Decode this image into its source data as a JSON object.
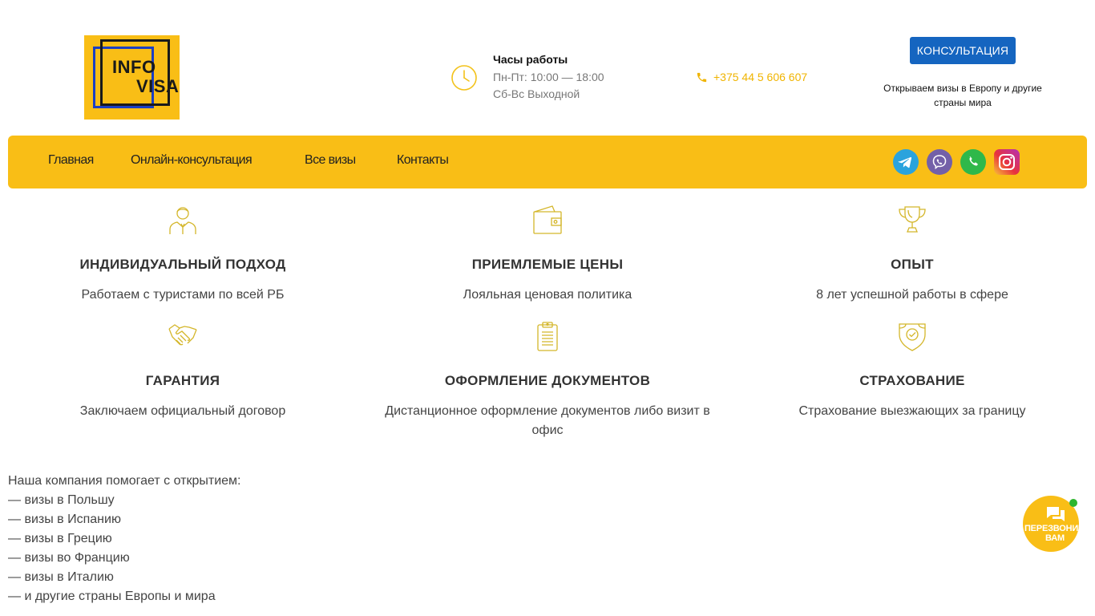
{
  "header": {
    "logo": {
      "line1": "INFO",
      "line2": "VISA"
    },
    "hours": {
      "title": "Часы работы",
      "weekdays": "Пн-Пт: 10:00 — 18:00",
      "weekend": "Сб-Вс Выходной"
    },
    "phone": "+375 44 5 606 607",
    "consult_button": "КОНСУЛЬТАЦИЯ",
    "consult_subtitle": "Открываем визы в Европу и другие страны мира"
  },
  "nav": {
    "items": [
      {
        "label": "Главная"
      },
      {
        "label": "Онлайн-консультация"
      },
      {
        "label": "Все визы"
      },
      {
        "label": "Контакты"
      }
    ],
    "social": [
      "telegram-icon",
      "viber-icon",
      "whatsapp-icon",
      "instagram-icon"
    ]
  },
  "features": [
    {
      "icon": "consultant-icon",
      "title": "ИНДИВИДУАЛЬНЫЙ ПОДХОД",
      "desc": "Работаем с туристами по всей РБ"
    },
    {
      "icon": "wallet-icon",
      "title": "ПРИЕМЛЕМЫЕ ЦЕНЫ",
      "desc": "Лояльная ценовая политика"
    },
    {
      "icon": "trophy-icon",
      "title": "ОПЫТ",
      "desc": "8 лет успешной работы в сфере"
    },
    {
      "icon": "handshake-icon",
      "title": "ГАРАНТИЯ",
      "desc": "Заключаем официальный договор"
    },
    {
      "icon": "clipboard-icon",
      "title": "ОФОРМЛЕНИЕ ДОКУМЕНТОВ",
      "desc": "Дистанционное оформление документов либо визит в офис"
    },
    {
      "icon": "shield-check-icon",
      "title": "СТРАХОВАНИЕ",
      "desc": "Страхование выезжающих за границу"
    }
  ],
  "about": {
    "intro": "Наша компания помогает с открытием:",
    "items": [
      "— визы в Польшу",
      "— визы в Испанию",
      "— визы в Грецию",
      "— визы во Францию",
      "— визы в Италию",
      "— и другие страны Европы и мира"
    ]
  },
  "callback": {
    "line1": "ПЕРЕЗВОНИМ",
    "line2": "ВАМ"
  },
  "colors": {
    "accent": "#f9be16",
    "button": "#1565c0",
    "icon": "#d4b62a"
  }
}
